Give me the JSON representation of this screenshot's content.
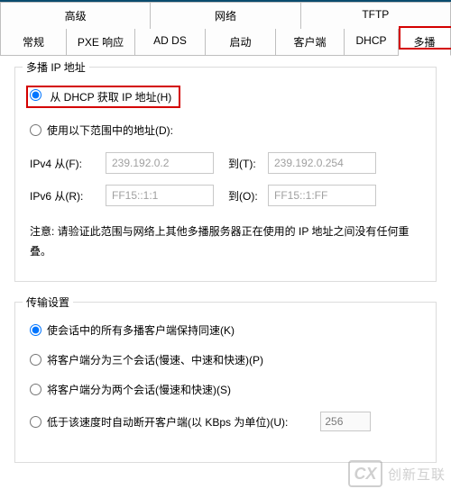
{
  "tabs_row1": {
    "advanced": "高级",
    "network": "网络",
    "tftp": "TFTP"
  },
  "tabs_row2": {
    "general": "常规",
    "pxe": "PXE 响应",
    "adds": "AD DS",
    "boot": "启动",
    "client": "客户端",
    "dhcp": "DHCP",
    "multicast": "多播"
  },
  "multicast_group": {
    "title": "多播 IP 地址",
    "radio_dhcp": "从 DHCP 获取 IP 地址(H)",
    "radio_range": "使用以下范围中的地址(D):",
    "ipv4_from_label": "IPv4   从(F):",
    "ipv4_from_value": "239.192.0.2",
    "ipv4_to_label": "到(T):",
    "ipv4_to_value": "239.192.0.254",
    "ipv6_from_label": "IPv6   从(R):",
    "ipv6_from_value": "FF15::1:1",
    "ipv6_to_label": "到(O):",
    "ipv6_to_value": "FF15::1:FF",
    "note": "注意: 请验证此范围与网络上其他多播服务器正在使用的 IP 地址之间没有任何重叠。"
  },
  "transfer_group": {
    "title": "传输设置",
    "radio_keep": "使会话中的所有多播客户端保持同速(K)",
    "radio_three": "将客户端分为三个会话(慢速、中速和快速)(P)",
    "radio_two": "将客户端分为两个会话(慢速和快速)(S)",
    "radio_disconnect": "低于该速度时自动断开客户端(以 KBps 为单位)(U):",
    "kbps_value": "256"
  },
  "watermark": {
    "logo": "CX",
    "text": "创新互联"
  }
}
